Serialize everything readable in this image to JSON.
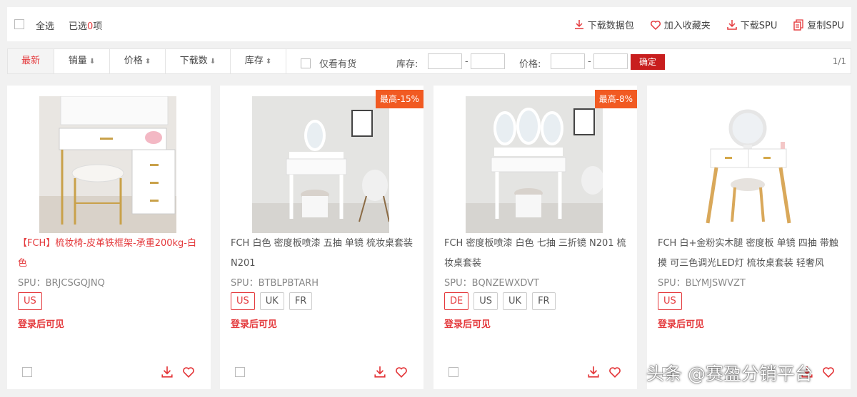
{
  "topbar": {
    "select_all": "全选",
    "selected_prefix": "已选",
    "selected_count": "0",
    "selected_suffix": "项",
    "actions": [
      {
        "label": "下载数据包",
        "icon": "download-icon"
      },
      {
        "label": "加入收藏夹",
        "icon": "heart-icon"
      },
      {
        "label": "下载SPU",
        "icon": "download-tray-icon"
      },
      {
        "label": "复制SPU",
        "icon": "copy-icon"
      }
    ]
  },
  "filters": {
    "tabs": [
      {
        "label": "最新",
        "arrow": ""
      },
      {
        "label": "销量",
        "arrow": "⬇"
      },
      {
        "label": "价格",
        "arrow": "⬍"
      },
      {
        "label": "下载数",
        "arrow": "⬇"
      },
      {
        "label": "库存",
        "arrow": "⬍"
      }
    ],
    "in_stock_only": "仅看有货",
    "stock_label": "库存:",
    "price_label": "价格:",
    "dash": "-",
    "confirm": "确定",
    "page": "1/1"
  },
  "products": [
    {
      "title": "【FCH】梳妆椅-皮革铁框架-承重200kg-白色",
      "spu": "SPU：BRJCSGQJNQ",
      "badge": "",
      "countries": [
        "US"
      ],
      "login_notice": "登录后可见"
    },
    {
      "title": "FCH 白色 密度板喷漆 五抽 单镜 梳妆桌套装 N201",
      "spu": "SPU：BTBLPBTARH",
      "badge": "最高-15%",
      "countries": [
        "US",
        "UK",
        "FR"
      ],
      "login_notice": "登录后可见"
    },
    {
      "title": "FCH 密度板喷漆 白色 七抽 三折镜 N201 梳妆桌套装",
      "spu": "SPU：BQNZEWXDVT",
      "badge": "最高-8%",
      "countries": [
        "DE",
        "US",
        "UK",
        "FR"
      ],
      "login_notice": "登录后可见"
    },
    {
      "title": "FCH 白+金粉实木腿 密度板 单镜 四抽 带触摸 可三色调光LED灯 梳妆桌套装 轻奢风",
      "spu": "SPU：BLYMJSWVZT",
      "badge": "",
      "countries": [
        "US"
      ],
      "login_notice": "登录后可见"
    }
  ],
  "watermark": "头条 @赛盈分销平台",
  "colors": {
    "accent": "#e4393c",
    "badge": "#f15a22",
    "confirm": "#c81e1e"
  }
}
